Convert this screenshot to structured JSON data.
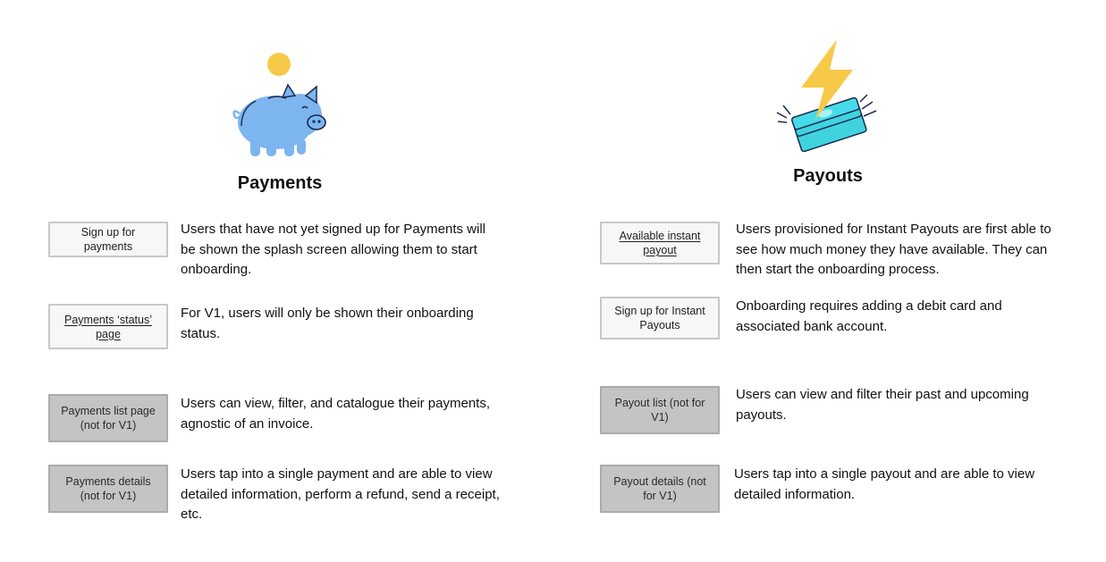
{
  "payments": {
    "title": "Payments",
    "rows": [
      {
        "label": "Sign up for payments",
        "style": "light",
        "link": false,
        "desc": "Users that have not yet signed up for Payments will be shown the splash screen allowing them to start onboarding."
      },
      {
        "label": "Payments ‘status’ page",
        "style": "light",
        "link": true,
        "desc": "For V1, users will only be shown their onboarding status."
      },
      {
        "label": "Payments list page (not for V1)",
        "style": "dark",
        "link": false,
        "desc": "Users can view, filter, and catalogue their payments, agnostic of an invoice."
      },
      {
        "label": "Payments details (not for V1)",
        "style": "dark",
        "link": false,
        "desc": "Users tap into a single payment and are able to view detailed information, perform a refund, send a receipt, etc."
      }
    ]
  },
  "payouts": {
    "title": "Payouts",
    "rows": [
      {
        "label": "Available instant payout",
        "style": "light",
        "link": true,
        "desc": "Users provisioned for Instant Payouts are first able to see how much money they have available. They can then start the onboarding process."
      },
      {
        "label": "Sign up for Instant Payouts",
        "style": "light",
        "link": false,
        "desc": "Onboarding requires adding a debit card and associated bank account."
      },
      {
        "label": "Payout list (not for V1)",
        "style": "dark",
        "link": false,
        "desc": "Users can view and filter their past and upcoming payouts."
      },
      {
        "label": "Payout details (not for V1)",
        "style": "dark",
        "link": false,
        "desc": "Users tap into a single payout and are able to view detailed information."
      }
    ]
  },
  "colors": {
    "piggy": "#7cb5f0",
    "coin": "#f7c948",
    "bolt": "#f7c948",
    "cash": "#3fd3e0",
    "ink": "#1b2a4a"
  },
  "icons": {
    "payments": "piggy-bank-icon",
    "payouts": "lightning-cash-icon"
  }
}
